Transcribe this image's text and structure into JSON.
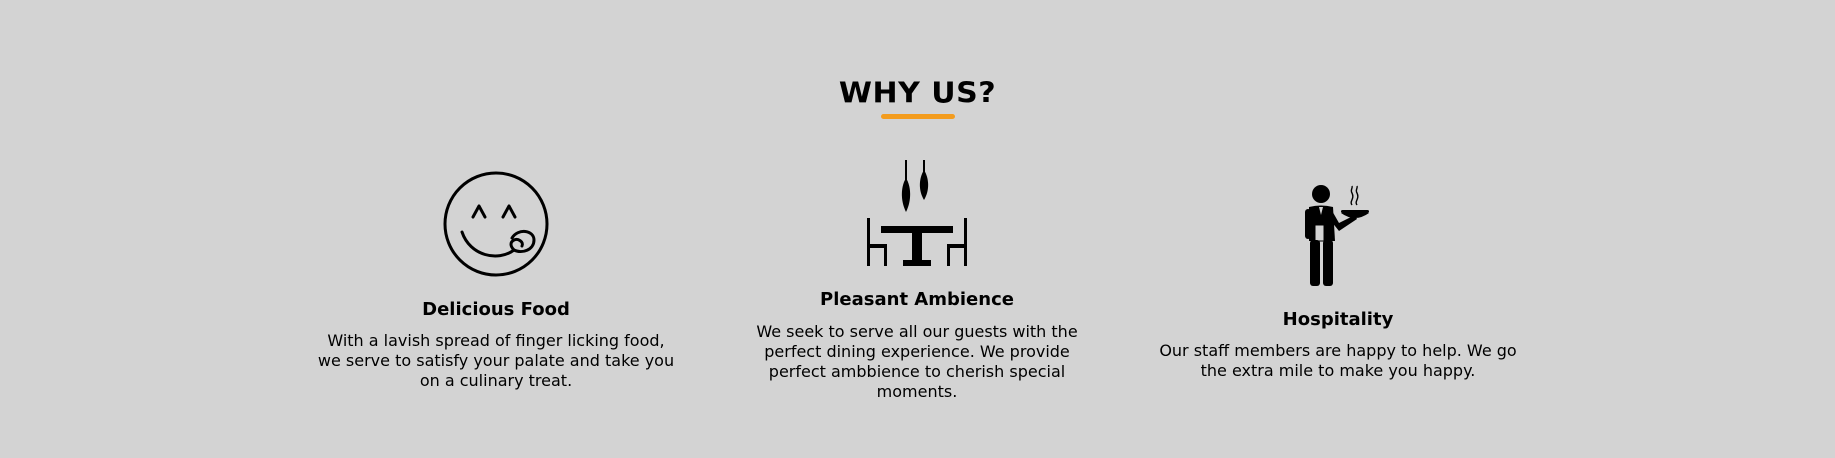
{
  "section": {
    "title": "WHY US?",
    "accent_color": "#f39c1e"
  },
  "features": [
    {
      "icon": "smiley-licking-icon",
      "heading": "Delicious Food",
      "description": "With a lavish spread of finger licking food, we serve to satisfy your palate and take you on a culinary treat."
    },
    {
      "icon": "dining-table-icon",
      "heading": "Pleasant Ambience",
      "description": "We seek to serve all our guests with the perfect dining experience. We provide perfect ambbience to cherish special moments."
    },
    {
      "icon": "waiter-icon",
      "heading": "Hospitality",
      "description": "Our staff members are happy to help. We go the extra mile to make you happy."
    }
  ]
}
